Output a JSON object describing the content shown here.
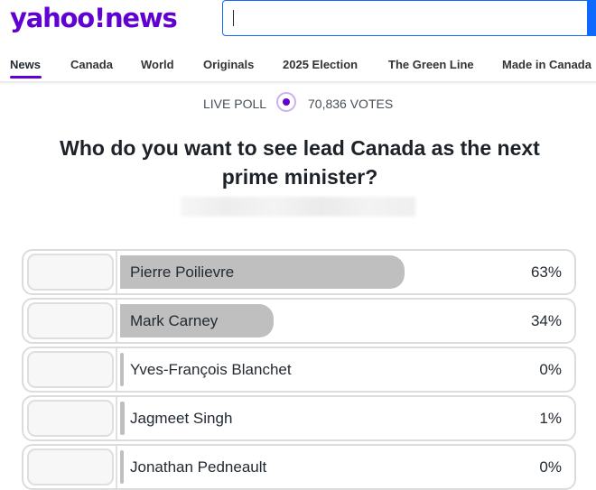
{
  "header": {
    "logo_text": "yahoo!news",
    "search_value": ""
  },
  "nav": {
    "items": [
      {
        "label": "News",
        "active": true
      },
      {
        "label": "Canada",
        "active": false
      },
      {
        "label": "World",
        "active": false
      },
      {
        "label": "Originals",
        "active": false
      },
      {
        "label": "2025 Election",
        "active": false
      },
      {
        "label": "The Green Line",
        "active": false
      },
      {
        "label": "Made in Canada",
        "active": false
      }
    ]
  },
  "poll": {
    "live_label": "LIVE POLL",
    "votes_label": "70,836 VOTES",
    "question": "Who do you want to see lead Canada as the next prime minister?",
    "options": [
      {
        "name": "Pierre Poilievre",
        "percent_label": "63%",
        "fill_fraction": 0.63
      },
      {
        "name": "Mark Carney",
        "percent_label": "34%",
        "fill_fraction": 0.34
      },
      {
        "name": "Yves-François Blanchet",
        "percent_label": "0%",
        "fill_fraction": 0.0
      },
      {
        "name": "Jagmeet Singh",
        "percent_label": "1%",
        "fill_fraction": 0.01
      },
      {
        "name": "Jonathan Pedneault",
        "percent_label": "0%",
        "fill_fraction": 0.0
      }
    ],
    "fill_color": "#bfbfbf"
  },
  "colors": {
    "brand": "#6001d2",
    "search_accent": "#0f69ff"
  }
}
